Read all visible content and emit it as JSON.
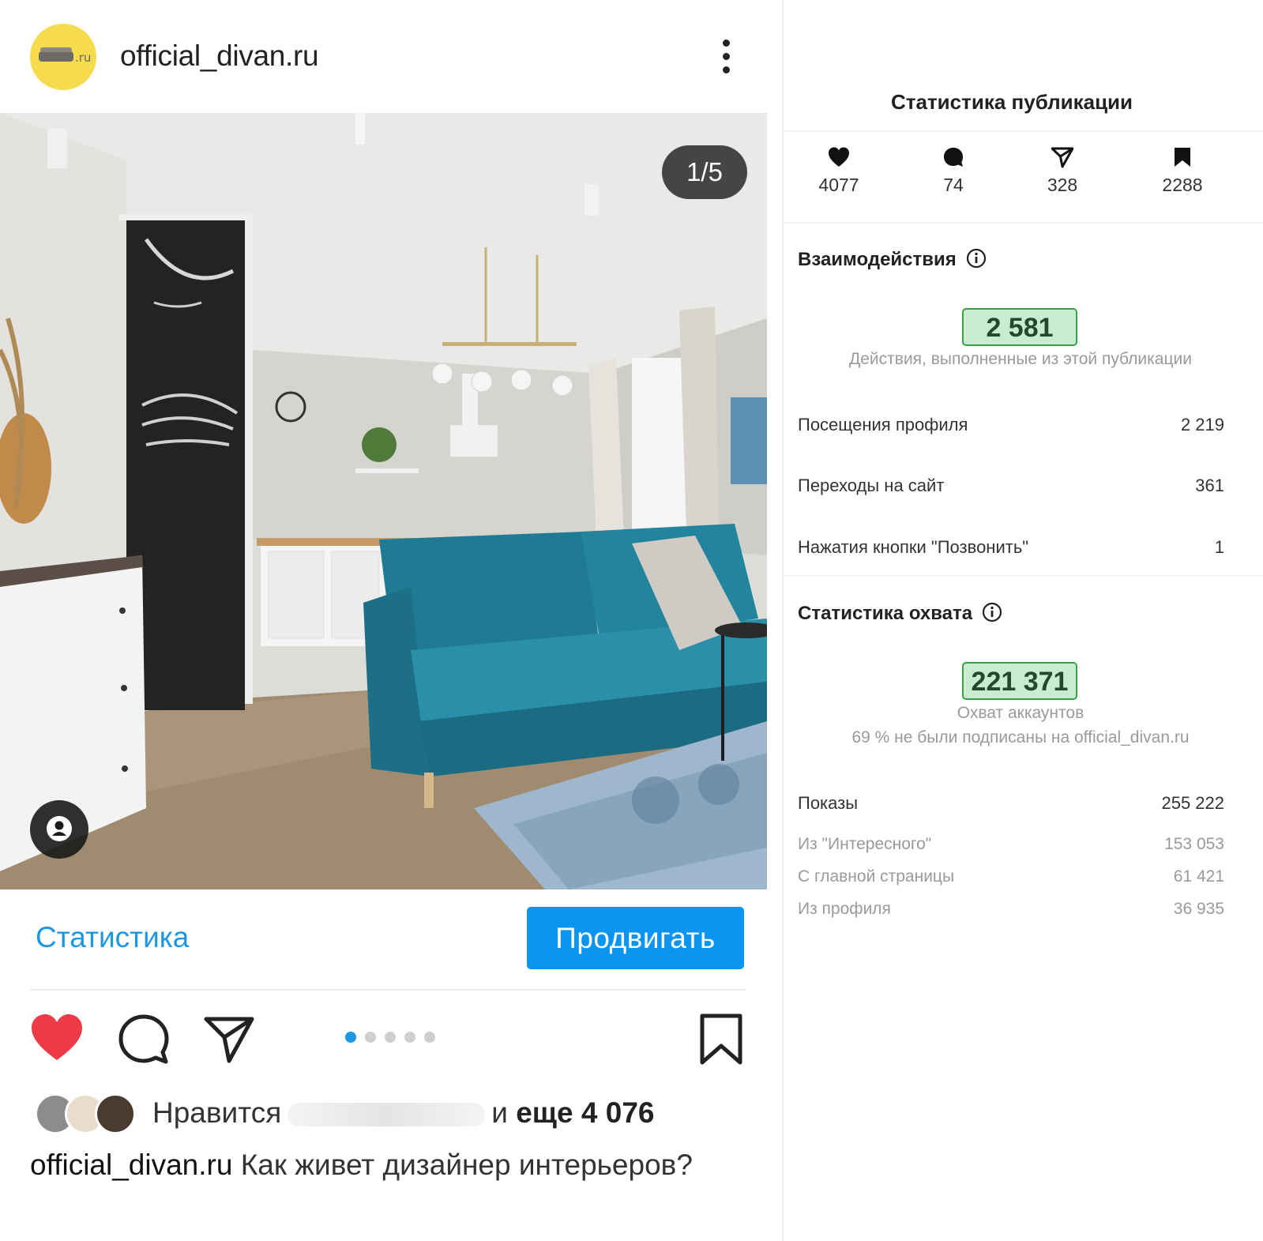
{
  "post": {
    "username": "official_divan.ru",
    "avatar_suffix": ".ru",
    "image_counter": "1/5",
    "statistics_link": "Статистика",
    "promote_button": "Продвигать",
    "carousel": {
      "total": 5,
      "active": 1
    },
    "likes_prefix": "Нравится",
    "likes_suffix_and": "и",
    "likes_suffix_count": "еще 4 076",
    "caption_user": "official_divan.ru",
    "caption_text": "Как живет дизайнер интерьеров?",
    "icons": {
      "more": "more-vertical-icon",
      "tag": "person-tag-icon",
      "like": "heart-filled-icon",
      "comment": "comment-icon",
      "share": "send-icon",
      "save": "bookmark-icon"
    },
    "colors": {
      "link": "#1f96e0",
      "promote": "#0b95f0",
      "heart": "#ee3b49",
      "avatar_bg": "#f6dc4c"
    }
  },
  "panel": {
    "title": "Статистика публикации",
    "metrics": [
      {
        "icon": "heart-icon",
        "value": "4077"
      },
      {
        "icon": "comment-icon",
        "value": "74"
      },
      {
        "icon": "send-icon",
        "value": "328"
      },
      {
        "icon": "bookmark-icon",
        "value": "2288"
      }
    ],
    "interactions": {
      "title": "Взаимодействия",
      "big_value": "2 581",
      "caption": "Действия, выполненные из этой публикации",
      "rows": [
        {
          "label": "Посещения профиля",
          "value": "2 219"
        },
        {
          "label": "Переходы на сайт",
          "value": "361"
        },
        {
          "label": "Нажатия кнопки \"Позвонить\"",
          "value": "1"
        }
      ]
    },
    "reach": {
      "title": "Статистика охвата",
      "big_value": "221 371",
      "caption1": "Охват аккаунтов",
      "caption2": "69 % не были подписаны на official_divan.ru",
      "impressions": {
        "label": "Показы",
        "value": "255 222"
      },
      "sub_rows": [
        {
          "label": "Из \"Интересного\"",
          "value": "153 053"
        },
        {
          "label": "С главной страницы",
          "value": "61 421"
        },
        {
          "label": "Из профиля",
          "value": "36 935"
        }
      ]
    },
    "colors": {
      "highlight_bg": "#c8ecd0",
      "highlight_border": "#3aa04a"
    }
  }
}
